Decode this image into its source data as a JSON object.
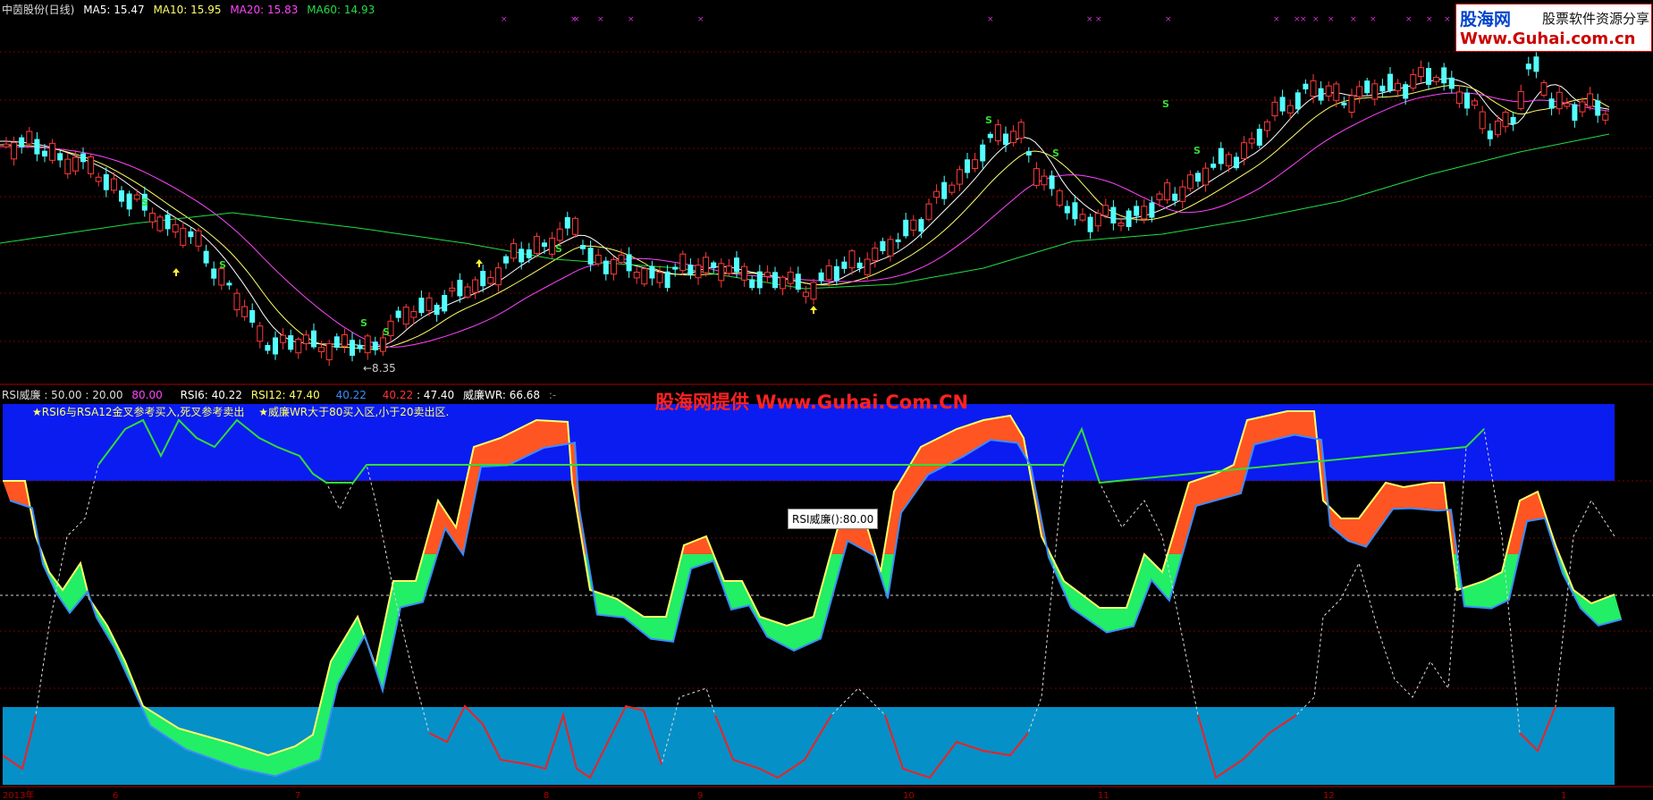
{
  "price_panel": {
    "title": "中茵股份(日线)",
    "ma5": "MA5: 15.47",
    "ma10": "MA10: 15.95",
    "ma20": "MA20: 15.83",
    "ma60": "MA60: 14.93",
    "low_label": "←8.35",
    "colors": {
      "up": "#ff3a3a",
      "down": "#54ffff",
      "ma5": "#ffffff",
      "ma10": "#ffff66",
      "ma20": "#ff44ff",
      "ma60": "#22dd44"
    }
  },
  "indicator_panel": {
    "name": "RSI威廉",
    "params": ": 50.00 : 20.00",
    "p3": "80.00",
    "rsi6": "RSI6: 40.22",
    "rsi12": "RSI12: 47.40",
    "v1": "40.22",
    "v2": "40.22",
    "v3": ": 47.40",
    "wr": "威廉WR: 66.68",
    "dash": ":-",
    "note1": "★RSI6与RSA12金叉参考买入,死叉参考卖出",
    "note2": "★威廉WR大于80买入区,小于20卖出区."
  },
  "watermark": {
    "line1a": "股海网",
    "line1b": "股票软件资源分享",
    "line2": "Www.Guhai.com.cn"
  },
  "banner": "股海网提供 Www.Guhai.Com.CN",
  "tooltip": "RSI威廉():80.00",
  "date_axis": [
    "2013年",
    "6",
    "7",
    "8",
    "9",
    "10",
    "11",
    "12",
    "1"
  ]
}
